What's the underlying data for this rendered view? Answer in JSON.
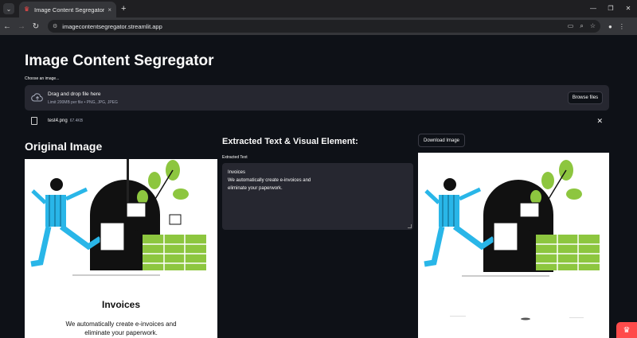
{
  "browser": {
    "tab_title": "Image Content Segregator · Str",
    "tab_close": "×",
    "new_tab": "+",
    "url": "imagecontentsegregator.streamlit.app"
  },
  "app": {
    "title": "Image Content Segregator",
    "uploader": {
      "label": "Choose an image...",
      "drop_title": "Drag and drop file here",
      "drop_sub": "Limit 200MB per file • PNG, JPG, JPEG",
      "browse_label": "Browse files"
    },
    "file": {
      "name": "test4.png",
      "size": "67.4KB"
    },
    "original_heading": "Original Image",
    "extracted_heading": "Extracted Text & Visual Element:",
    "extracted_label": "Extracted Text",
    "extracted_lines": [
      "Invoices",
      "We automatically create e-invoices and",
      "eliminate your paperwork."
    ],
    "download_label": "Download Image",
    "invoice": {
      "title": "Invoices",
      "line1": "We automatically create e-invoices and",
      "line2": "eliminate your paperwork."
    }
  },
  "colors": {
    "background": "#0e1117",
    "panel": "#262730",
    "accent": "#ff4b4b",
    "leaf": "#8dc63f",
    "figure": "#29b6e8"
  }
}
